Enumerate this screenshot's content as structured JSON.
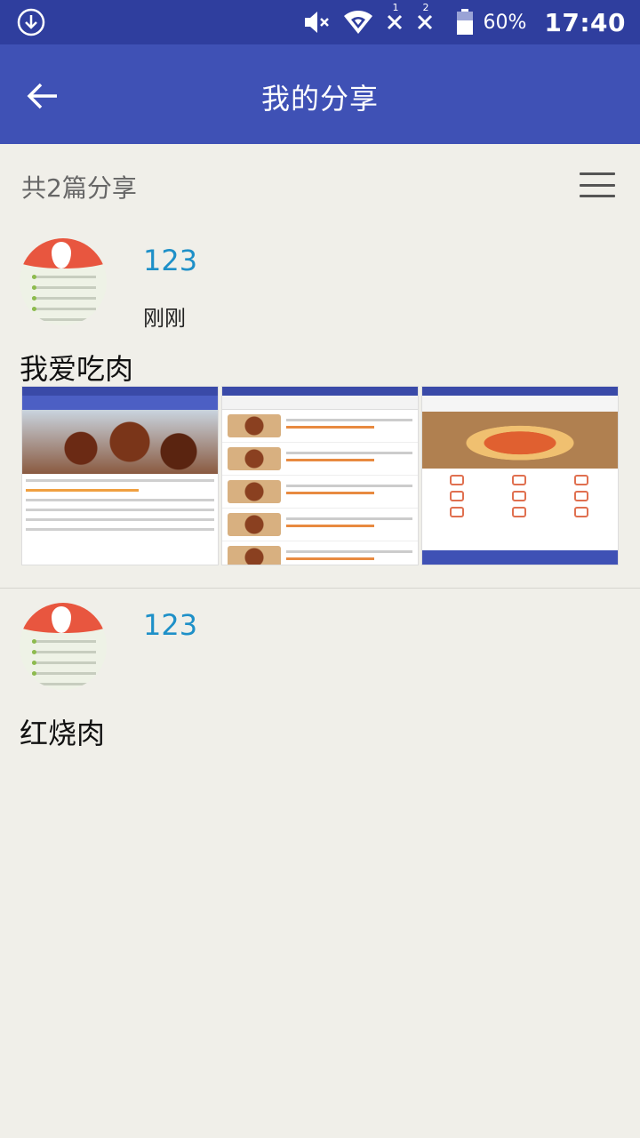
{
  "status_bar": {
    "battery_percent": "60%",
    "time": "17:40",
    "sim1_label": "1",
    "sim2_label": "2",
    "icons": [
      "download-icon",
      "mute-icon",
      "wifi-icon",
      "sim1-no-signal-icon",
      "sim2-no-signal-icon",
      "battery-icon"
    ]
  },
  "app_bar": {
    "title": "我的分享",
    "back_icon": "arrow-left-icon"
  },
  "summary": {
    "count_text": "共2篇分享",
    "menu_icon": "hamburger-menu-icon"
  },
  "posts": [
    {
      "username": "123",
      "time": "刚刚",
      "text": "我爱吃肉",
      "images": [
        "recipe-detail-screenshot",
        "recipe-list-screenshot",
        "home-screen-screenshot"
      ]
    },
    {
      "username": "123",
      "text": "红烧肉"
    }
  ],
  "colors": {
    "status_bar": "#2f3e9e",
    "app_bar": "#3f51b5",
    "background": "#f0efe9",
    "username": "#1e90c8"
  }
}
